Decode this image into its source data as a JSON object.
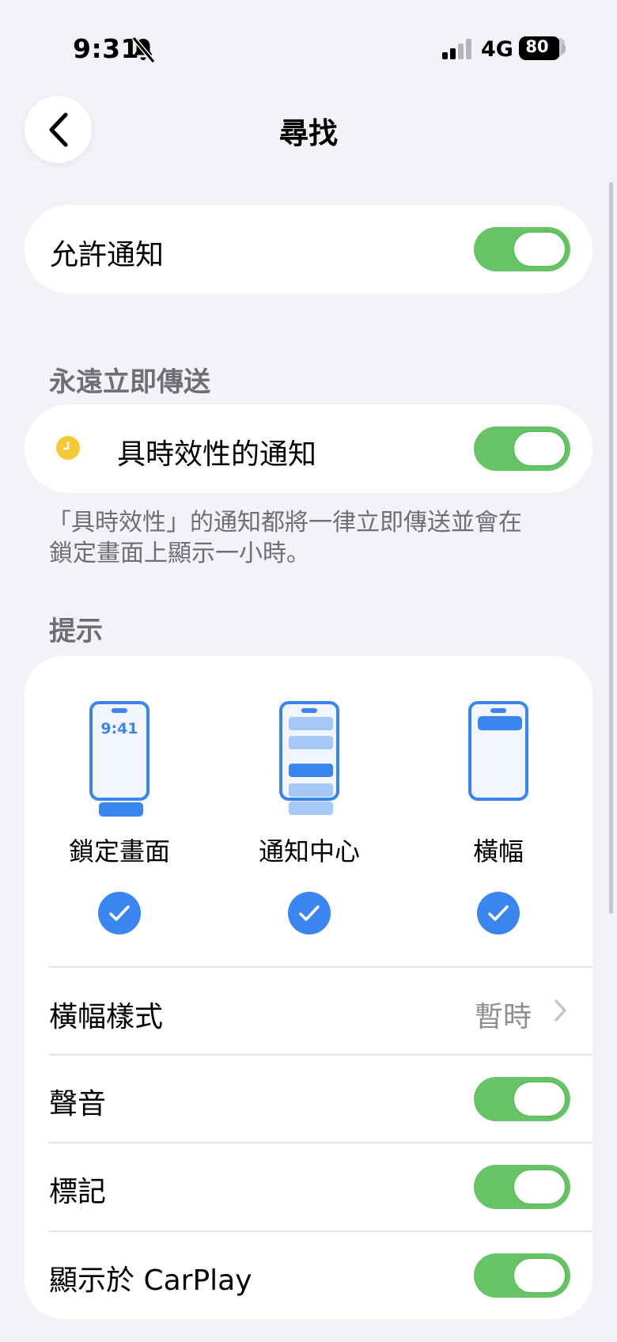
{
  "status_bar": {
    "time": "9:31",
    "network": "4G",
    "battery": "80",
    "battery_level": 0.8
  },
  "nav": {
    "title": "尋找"
  },
  "allow_notifications": {
    "label": "允許通知",
    "on": true
  },
  "immediate": {
    "header": "永遠立即傳送",
    "time_sensitive": {
      "label": "具時效性的通知",
      "on": true
    },
    "footnote_line1": "「具時效性」的通知都將一律立即傳送並會在",
    "footnote_line2": "鎖定畫面上顯示一小時。"
  },
  "alerts": {
    "header": "提示",
    "styles": [
      {
        "label": "鎖定畫面",
        "preview_time": "9:41",
        "checked": true
      },
      {
        "label": "通知中心",
        "checked": true
      },
      {
        "label": "橫幅",
        "checked": true
      }
    ],
    "banner_style": {
      "label": "橫幅樣式",
      "value": "暫時"
    },
    "sounds": {
      "label": "聲音",
      "on": true
    },
    "badges": {
      "label": "標記",
      "on": true
    },
    "carplay": {
      "label": "顯示於 CarPlay",
      "on": true
    }
  },
  "colors": {
    "accent": "#3a86ee",
    "toggle_on": "#67c466",
    "clock_icon": "#f5c835"
  }
}
